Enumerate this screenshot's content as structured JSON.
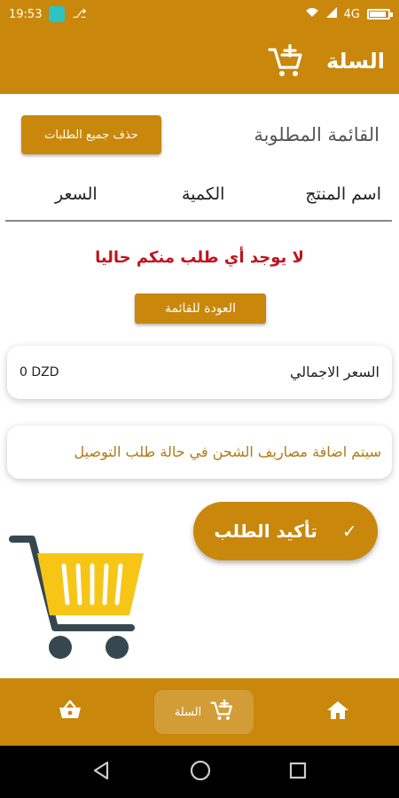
{
  "status_bar": {
    "time": "19:53",
    "network": "4G"
  },
  "app_bar": {
    "title": "السلة",
    "cart_icon": "cart-add-icon"
  },
  "list": {
    "title": "القائمة المطلوبة",
    "delete_all_label": "حذف جميع الطلبات",
    "columns": {
      "product_name": "اسم المنتج",
      "quantity": "الكمية",
      "price": "السعر"
    },
    "empty_message": "لا يوجد أي طلب منكم حاليا",
    "back_label": "العودة للقائمة"
  },
  "total": {
    "label": "السعر الاجمالي",
    "value": "0 DZD"
  },
  "note": {
    "text": "سيتم اضافة مصاريف الشحن في حالة طلب التوصيل"
  },
  "confirm": {
    "label": "تأكيد الطلب"
  },
  "bottom_nav": {
    "cart_label": "السلة"
  },
  "colors": {
    "accent": "#c9870b",
    "error": "#c0121e",
    "note": "#b07a14",
    "cart_yellow": "#f6c516",
    "cart_dark": "#37474f"
  }
}
